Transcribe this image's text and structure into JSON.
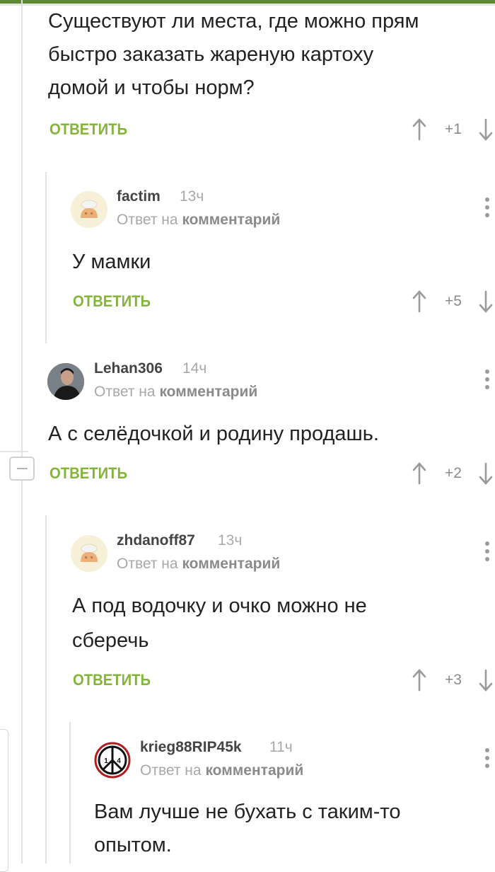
{
  "root": {
    "text": [
      "Существуют ли места, где можно прям",
      "быстро заказать жареную картоху",
      "домой и чтобы норм?"
    ],
    "reply": "ОТВЕТИТЬ",
    "score": "+1"
  },
  "comments": [
    {
      "user": "factim",
      "time": "13ч",
      "meta_prefix": "Ответ на",
      "meta_link": "комментарий",
      "text": [
        "У мамки"
      ],
      "reply": "ОТВЕТИТЬ",
      "score": "+5"
    },
    {
      "user": "Lehan306",
      "time": "14ч",
      "meta_prefix": "Ответ на",
      "meta_link": "комментарий",
      "text": [
        "А с селёдочкой и родину продашь."
      ],
      "reply": "ОТВЕТИТЬ",
      "score": "+2"
    },
    {
      "user": "zhdanoff87",
      "time": "13ч",
      "meta_prefix": "Ответ на",
      "meta_link": "комментарий",
      "text": [
        "А под водочку и очко можно не",
        "сберечь"
      ],
      "reply": "ОТВЕТИТЬ",
      "score": "+3"
    },
    {
      "user": "krieg88RIP45k",
      "time": "11ч",
      "meta_prefix": "Ответ на",
      "meta_link": "комментарий",
      "text": [
        "Вам лучше не бухать с таким-то",
        "опытом."
      ]
    }
  ],
  "avatar_labels": {
    "peace_left": "1",
    "peace_right": "4"
  },
  "colors": {
    "accent": "#83b53a",
    "top_bar": "#5d8a33",
    "muted": "#a8a8a8"
  }
}
